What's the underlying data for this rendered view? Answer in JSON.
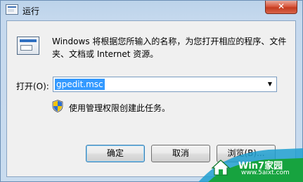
{
  "window": {
    "title": "运行",
    "close_glyph": "✕"
  },
  "dialog": {
    "description": "Windows 将根据您所输入的名称，为您打开相应的程序、文件夹、文档或 Internet 资源。",
    "open_label": "打开(O):",
    "input_value": "gpedit.msc",
    "admin_note": "使用管理权限创建此任务。",
    "ok_label": "确定",
    "cancel_label": "取消",
    "browse_label": "浏览(B)..."
  },
  "watermark": {
    "partial_text": "浏览(B)...",
    "brand": "Win7家园",
    "site": "www.5aixt.com"
  },
  "icons": {
    "app": "run-icon",
    "shield": "uac-shield-icon",
    "dropdown": "chevron-down-icon",
    "watermark_logo": "house-logo-icon"
  },
  "colors": {
    "selection": "#3399ff",
    "close_button": "#c43b1f",
    "frame": "#c9dcef",
    "watermark_green": "#1e9a3a"
  }
}
